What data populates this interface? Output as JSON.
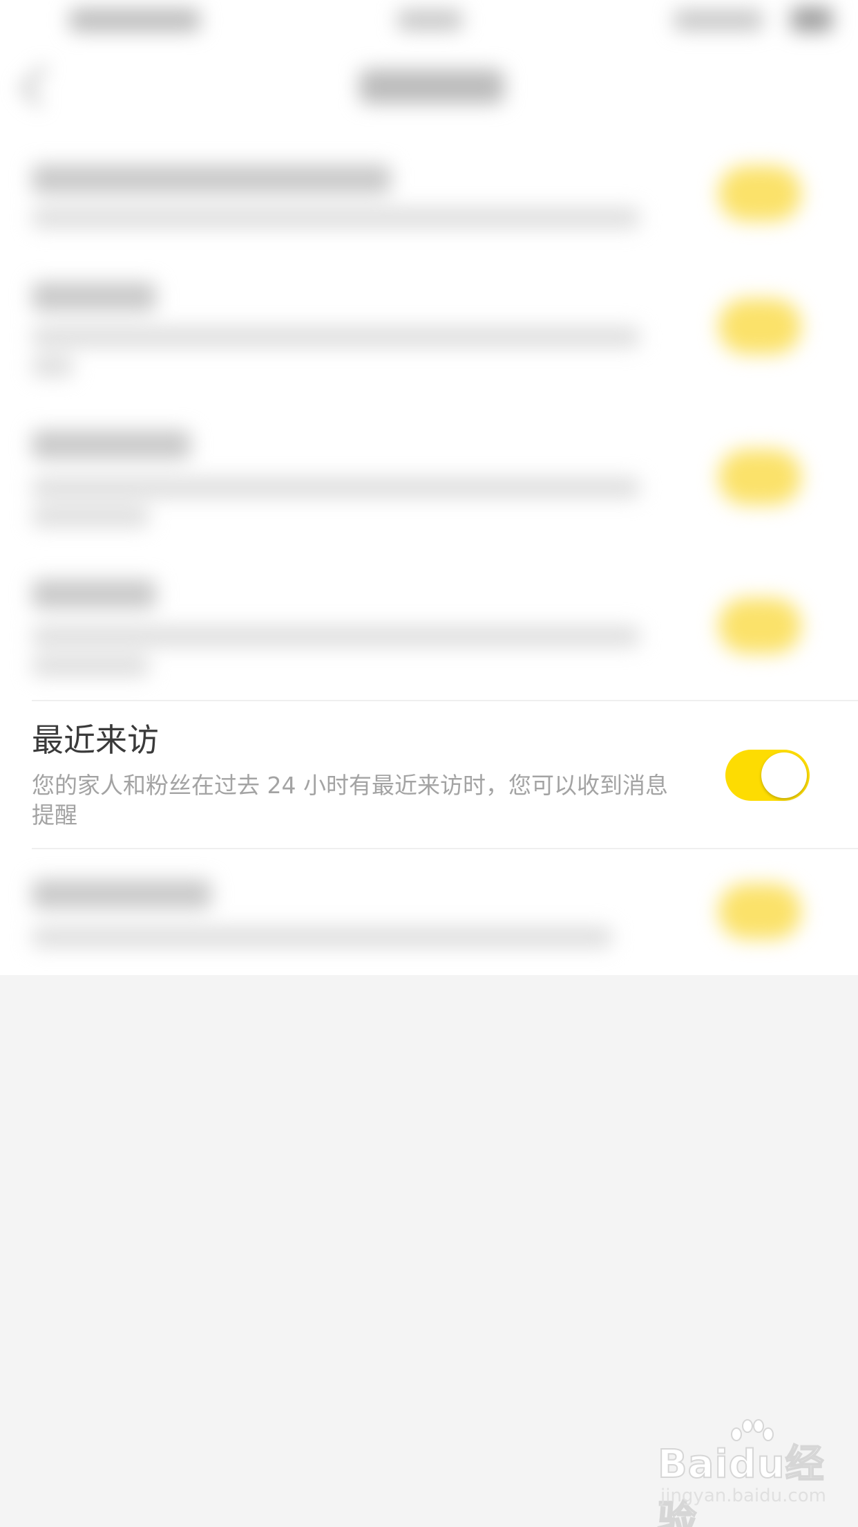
{
  "setting": {
    "title": "最近来访",
    "description": "您的家人和粉丝在过去 24 小时有最近来访时，您可以收到消息提醒",
    "enabled": true,
    "toggle_color": "#fddc02"
  },
  "watermark": {
    "logo": "Baidu经验",
    "url": "jingyan.baidu.com"
  }
}
